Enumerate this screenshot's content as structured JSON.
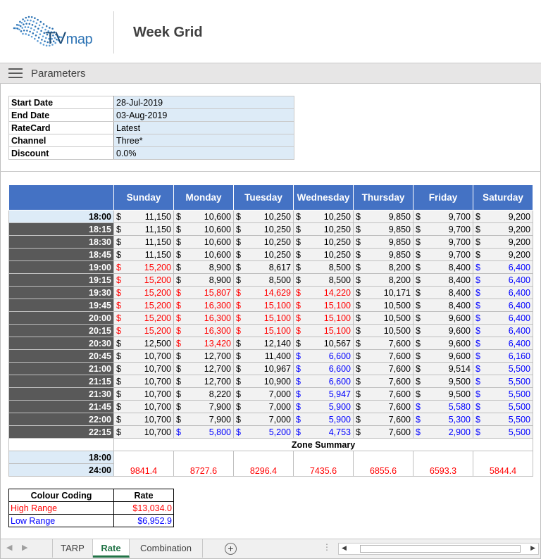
{
  "header": {
    "logo_tv": "TV",
    "logo_map": "map",
    "title": "Week Grid"
  },
  "parameters_bar": {
    "title": "Parameters"
  },
  "parameters": [
    {
      "label": "Start Date",
      "value": "28-Jul-2019"
    },
    {
      "label": "End Date",
      "value": "03-Aug-2019"
    },
    {
      "label": "RateCard",
      "value": "Latest"
    },
    {
      "label": "Channel",
      "value": "Three*"
    },
    {
      "label": "Discount",
      "value": "0.0%"
    }
  ],
  "grid": {
    "currency": "$",
    "days": [
      "Sunday",
      "Monday",
      "Tuesday",
      "Wednesday",
      "Thursday",
      "Friday",
      "Saturday"
    ],
    "rows": [
      {
        "time": "18:00",
        "values": [
          "11,150",
          "10,600",
          "10,250",
          "10,250",
          "9,850",
          "9,700",
          "9,200"
        ],
        "colors": [
          "",
          "",
          "",
          "",
          "",
          "",
          ""
        ]
      },
      {
        "time": "18:15",
        "values": [
          "11,150",
          "10,600",
          "10,250",
          "10,250",
          "9,850",
          "9,700",
          "9,200"
        ],
        "colors": [
          "",
          "",
          "",
          "",
          "",
          "",
          ""
        ]
      },
      {
        "time": "18:30",
        "values": [
          "11,150",
          "10,600",
          "10,250",
          "10,250",
          "9,850",
          "9,700",
          "9,200"
        ],
        "colors": [
          "",
          "",
          "",
          "",
          "",
          "",
          ""
        ]
      },
      {
        "time": "18:45",
        "values": [
          "11,150",
          "10,600",
          "10,250",
          "10,250",
          "9,850",
          "9,700",
          "9,200"
        ],
        "colors": [
          "",
          "",
          "",
          "",
          "",
          "",
          ""
        ]
      },
      {
        "time": "19:00",
        "values": [
          "15,200",
          "8,900",
          "8,617",
          "8,500",
          "8,200",
          "8,400",
          "6,400"
        ],
        "colors": [
          "red",
          "",
          "",
          "",
          "",
          "",
          "blue"
        ]
      },
      {
        "time": "19:15",
        "values": [
          "15,200",
          "8,900",
          "8,500",
          "8,500",
          "8,200",
          "8,400",
          "6,400"
        ],
        "colors": [
          "red",
          "",
          "",
          "",
          "",
          "",
          "blue"
        ]
      },
      {
        "time": "19:30",
        "values": [
          "15,200",
          "15,807",
          "14,629",
          "14,220",
          "10,171",
          "8,400",
          "6,400"
        ],
        "colors": [
          "red",
          "red",
          "red",
          "red",
          "",
          "",
          "blue"
        ]
      },
      {
        "time": "19:45",
        "values": [
          "15,200",
          "16,300",
          "15,100",
          "15,100",
          "10,500",
          "8,400",
          "6,400"
        ],
        "colors": [
          "red",
          "red",
          "red",
          "red",
          "",
          "",
          "blue"
        ]
      },
      {
        "time": "20:00",
        "values": [
          "15,200",
          "16,300",
          "15,100",
          "15,100",
          "10,500",
          "9,600",
          "6,400"
        ],
        "colors": [
          "red",
          "red",
          "red",
          "red",
          "",
          "",
          "blue"
        ]
      },
      {
        "time": "20:15",
        "values": [
          "15,200",
          "16,300",
          "15,100",
          "15,100",
          "10,500",
          "9,600",
          "6,400"
        ],
        "colors": [
          "red",
          "red",
          "red",
          "red",
          "",
          "",
          "blue"
        ]
      },
      {
        "time": "20:30",
        "values": [
          "12,500",
          "13,420",
          "12,140",
          "10,567",
          "7,600",
          "9,600",
          "6,400"
        ],
        "colors": [
          "",
          "red",
          "",
          "",
          "",
          "",
          "blue"
        ]
      },
      {
        "time": "20:45",
        "values": [
          "10,700",
          "12,700",
          "11,400",
          "6,600",
          "7,600",
          "9,600",
          "6,160"
        ],
        "colors": [
          "",
          "",
          "",
          "blue",
          "",
          "",
          "blue"
        ]
      },
      {
        "time": "21:00",
        "values": [
          "10,700",
          "12,700",
          "10,967",
          "6,600",
          "7,600",
          "9,514",
          "5,500"
        ],
        "colors": [
          "",
          "",
          "",
          "blue",
          "",
          "",
          "blue"
        ]
      },
      {
        "time": "21:15",
        "values": [
          "10,700",
          "12,700",
          "10,900",
          "6,600",
          "7,600",
          "9,500",
          "5,500"
        ],
        "colors": [
          "",
          "",
          "",
          "blue",
          "",
          "",
          "blue"
        ]
      },
      {
        "time": "21:30",
        "values": [
          "10,700",
          "8,220",
          "7,000",
          "5,947",
          "7,600",
          "9,500",
          "5,500"
        ],
        "colors": [
          "",
          "",
          "",
          "blue",
          "",
          "",
          "blue"
        ]
      },
      {
        "time": "21:45",
        "values": [
          "10,700",
          "7,900",
          "7,000",
          "5,900",
          "7,600",
          "5,580",
          "5,500"
        ],
        "colors": [
          "",
          "",
          "",
          "blue",
          "",
          "blue",
          "blue"
        ]
      },
      {
        "time": "22:00",
        "values": [
          "10,700",
          "7,900",
          "7,000",
          "5,900",
          "7,600",
          "5,300",
          "5,500"
        ],
        "colors": [
          "",
          "",
          "",
          "blue",
          "",
          "blue",
          "blue"
        ]
      },
      {
        "time": "22:15",
        "values": [
          "10,700",
          "5,800",
          "5,200",
          "4,753",
          "7,600",
          "2,900",
          "5,500"
        ],
        "colors": [
          "",
          "blue",
          "blue",
          "blue",
          "",
          "blue",
          "blue"
        ]
      }
    ],
    "zone_summary": {
      "title": "Zone Summary",
      "start": "18:00",
      "end": "24:00",
      "values": [
        "9841.4",
        "8727.6",
        "8296.4",
        "7435.6",
        "6855.6",
        "6593.3",
        "5844.4"
      ]
    }
  },
  "colour_coding": {
    "header_label": "Colour Coding",
    "header_rate": "Rate",
    "rows": [
      {
        "label": "High Range",
        "rate": "$13,034.0",
        "color": "red"
      },
      {
        "label": "Low Range",
        "rate": "$6,952.9",
        "color": "blue"
      }
    ]
  },
  "sheet_tabs": {
    "tabs": [
      "TARP",
      "Rate",
      "Combination"
    ],
    "active": "Rate",
    "add_label": "+"
  }
}
